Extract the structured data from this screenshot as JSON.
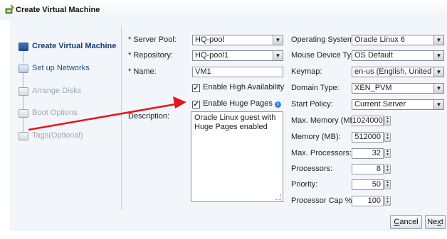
{
  "window": {
    "title": "Create Virtual Machine"
  },
  "train": {
    "steps": [
      {
        "label": "Create Virtual Machine",
        "state": "active"
      },
      {
        "label": "Set up Networks",
        "state": "next"
      },
      {
        "label": "Arrange Disks",
        "state": "disabled"
      },
      {
        "label": "Boot Options",
        "state": "disabled"
      },
      {
        "label": "Tags(Optional)",
        "state": "disabled"
      }
    ]
  },
  "form": {
    "server_pool": {
      "label": "* Server Pool:",
      "value": "HQ-pool"
    },
    "repository": {
      "label": "* Repository:",
      "value": "HQ-pool1"
    },
    "name": {
      "label": "* Name:",
      "value": "VM1"
    },
    "high_availability": {
      "label": "Enable High Availability",
      "checked": true
    },
    "huge_pages": {
      "label": "Enable Huge Pages",
      "checked": true
    },
    "description": {
      "label": "Description:",
      "value": "Oracle Linux guest with Huge Pages enabled"
    }
  },
  "settings": {
    "operating_system": {
      "label": "Operating System:",
      "value": "Oracle Linux 6"
    },
    "mouse_device_type": {
      "label": "Mouse Device Type:",
      "value": "OS Default"
    },
    "keymap": {
      "label": "Keymap:",
      "value": "en-us (English, United States)"
    },
    "domain_type": {
      "label": "Domain Type:",
      "value": "XEN_PVM"
    },
    "start_policy": {
      "label": "Start Policy:",
      "value": "Current Server"
    },
    "max_memory": {
      "label": "Max. Memory (MB):",
      "value": "1024000"
    },
    "memory": {
      "label": "Memory (MB):",
      "value": "512000"
    },
    "max_processors": {
      "label": "Max. Processors:",
      "value": "32"
    },
    "processors": {
      "label": "Processors:",
      "value": "8"
    },
    "priority": {
      "label": "Priority:",
      "value": "50"
    },
    "processor_cap": {
      "label": "Processor Cap %:",
      "value": "100"
    }
  },
  "buttons": {
    "cancel": {
      "pre": "",
      "u": "C",
      "post": "ancel"
    },
    "next": {
      "pre": "Ne",
      "u": "x",
      "post": "t"
    }
  },
  "colors": {
    "accent": "#173b74",
    "annotation_arrow": "#e8141b",
    "panel_bg": "#f2f6fa"
  },
  "icons": {
    "title": "vm-wizard-icon",
    "checkbox": "checkmark-icon",
    "info": "info-icon",
    "dropdown": "chevron-down-icon"
  }
}
